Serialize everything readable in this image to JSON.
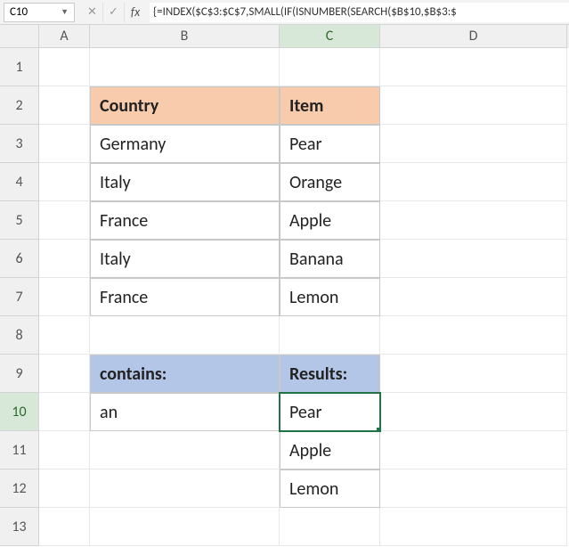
{
  "nameBox": "C10",
  "formula": "{=INDEX($C$3:$C$7,SMALL(IF(ISNUMBER(SEARCH($B$10,$B$3:$",
  "colHeaders": [
    "A",
    "B",
    "C",
    "D"
  ],
  "rowHeaders": [
    "1",
    "2",
    "3",
    "4",
    "5",
    "6",
    "7",
    "8",
    "9",
    "10",
    "11",
    "12",
    "13"
  ],
  "activeCol": "C",
  "activeRow": "10",
  "table1": {
    "headers": {
      "b": "Country",
      "c": "Item"
    },
    "rows": [
      {
        "b": "Germany",
        "c": "Pear"
      },
      {
        "b": "Italy",
        "c": "Orange"
      },
      {
        "b": "France",
        "c": "Apple"
      },
      {
        "b": "Italy",
        "c": "Banana"
      },
      {
        "b": "France",
        "c": "Lemon"
      }
    ]
  },
  "table2": {
    "headers": {
      "b": "contains:",
      "c": "Results:"
    },
    "b10": "an",
    "results": [
      "Pear",
      "Apple",
      "Lemon"
    ]
  }
}
